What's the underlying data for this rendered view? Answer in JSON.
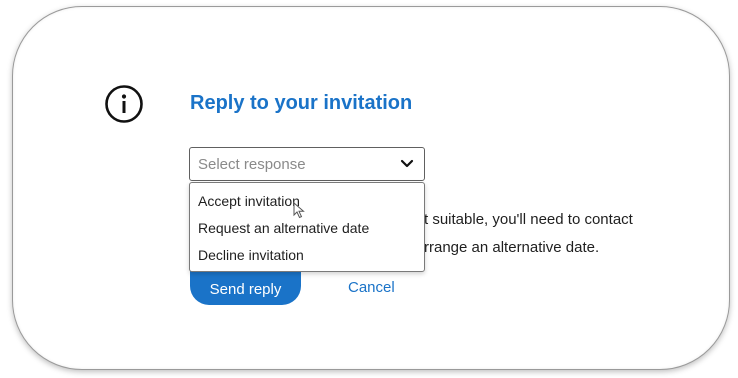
{
  "dialog": {
    "icon": "info-circle-icon",
    "title": "Reply to your invitation",
    "body_line_1": "t suitable, you'll need to contact",
    "body_line_2": "rrange an alternative date."
  },
  "select": {
    "placeholder": "Select response",
    "chevron_icon": "chevron-down-icon",
    "options": [
      {
        "label": "Accept invitation"
      },
      {
        "label": "Request an alternative date"
      },
      {
        "label": "Decline invitation"
      }
    ]
  },
  "actions": {
    "send_label": "Send reply",
    "cancel_label": "Cancel"
  },
  "colors": {
    "accent": "#1a73c8",
    "text": "#1f1f1f",
    "placeholder": "#8a8a8a"
  },
  "pointer": "mouse-cursor-icon"
}
